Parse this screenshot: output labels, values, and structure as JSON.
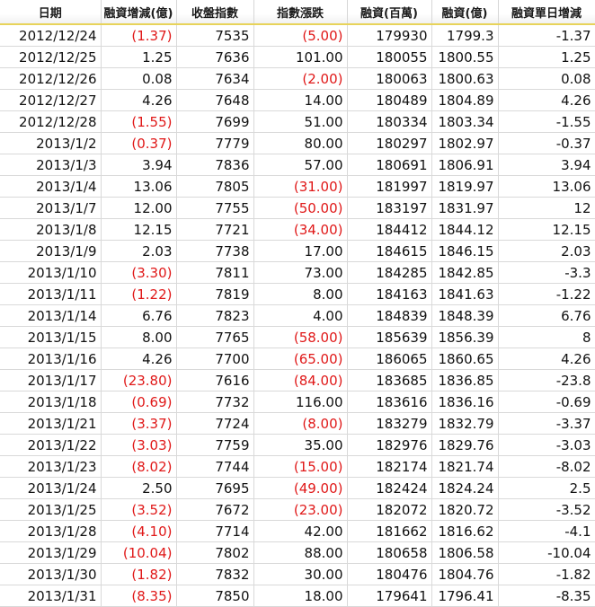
{
  "headers": [
    "日期",
    "融資增減(億)",
    "收盤指數",
    "指數漲跌",
    "融資(百萬)",
    "融資(億)",
    "融資單日增減"
  ],
  "colors": {
    "negative_text": "#e01818",
    "header_underline": "#e7d35a",
    "grid": "#d9d9d9"
  },
  "rows": [
    {
      "date": "2012/12/24",
      "margin_change": "(1.37)",
      "close": "7535",
      "index_change": "(5.00)",
      "margin_million": "179930",
      "margin_billion": "1799.3",
      "daily_change": "-1.37"
    },
    {
      "date": "2012/12/25",
      "margin_change": "1.25",
      "close": "7636",
      "index_change": "101.00",
      "margin_million": "180055",
      "margin_billion": "1800.55",
      "daily_change": "1.25"
    },
    {
      "date": "2012/12/26",
      "margin_change": "0.08",
      "close": "7634",
      "index_change": "(2.00)",
      "margin_million": "180063",
      "margin_billion": "1800.63",
      "daily_change": "0.08"
    },
    {
      "date": "2012/12/27",
      "margin_change": "4.26",
      "close": "7648",
      "index_change": "14.00",
      "margin_million": "180489",
      "margin_billion": "1804.89",
      "daily_change": "4.26"
    },
    {
      "date": "2012/12/28",
      "margin_change": "(1.55)",
      "close": "7699",
      "index_change": "51.00",
      "margin_million": "180334",
      "margin_billion": "1803.34",
      "daily_change": "-1.55"
    },
    {
      "date": "2013/1/2",
      "margin_change": "(0.37)",
      "close": "7779",
      "index_change": "80.00",
      "margin_million": "180297",
      "margin_billion": "1802.97",
      "daily_change": "-0.37"
    },
    {
      "date": "2013/1/3",
      "margin_change": "3.94",
      "close": "7836",
      "index_change": "57.00",
      "margin_million": "180691",
      "margin_billion": "1806.91",
      "daily_change": "3.94"
    },
    {
      "date": "2013/1/4",
      "margin_change": "13.06",
      "close": "7805",
      "index_change": "(31.00)",
      "margin_million": "181997",
      "margin_billion": "1819.97",
      "daily_change": "13.06"
    },
    {
      "date": "2013/1/7",
      "margin_change": "12.00",
      "close": "7755",
      "index_change": "(50.00)",
      "margin_million": "183197",
      "margin_billion": "1831.97",
      "daily_change": "12"
    },
    {
      "date": "2013/1/8",
      "margin_change": "12.15",
      "close": "7721",
      "index_change": "(34.00)",
      "margin_million": "184412",
      "margin_billion": "1844.12",
      "daily_change": "12.15"
    },
    {
      "date": "2013/1/9",
      "margin_change": "2.03",
      "close": "7738",
      "index_change": "17.00",
      "margin_million": "184615",
      "margin_billion": "1846.15",
      "daily_change": "2.03"
    },
    {
      "date": "2013/1/10",
      "margin_change": "(3.30)",
      "close": "7811",
      "index_change": "73.00",
      "margin_million": "184285",
      "margin_billion": "1842.85",
      "daily_change": "-3.3"
    },
    {
      "date": "2013/1/11",
      "margin_change": "(1.22)",
      "close": "7819",
      "index_change": "8.00",
      "margin_million": "184163",
      "margin_billion": "1841.63",
      "daily_change": "-1.22"
    },
    {
      "date": "2013/1/14",
      "margin_change": "6.76",
      "close": "7823",
      "index_change": "4.00",
      "margin_million": "184839",
      "margin_billion": "1848.39",
      "daily_change": "6.76"
    },
    {
      "date": "2013/1/15",
      "margin_change": "8.00",
      "close": "7765",
      "index_change": "(58.00)",
      "margin_million": "185639",
      "margin_billion": "1856.39",
      "daily_change": "8"
    },
    {
      "date": "2013/1/16",
      "margin_change": "4.26",
      "close": "7700",
      "index_change": "(65.00)",
      "margin_million": "186065",
      "margin_billion": "1860.65",
      "daily_change": "4.26"
    },
    {
      "date": "2013/1/17",
      "margin_change": "(23.80)",
      "close": "7616",
      "index_change": "(84.00)",
      "margin_million": "183685",
      "margin_billion": "1836.85",
      "daily_change": "-23.8"
    },
    {
      "date": "2013/1/18",
      "margin_change": "(0.69)",
      "close": "7732",
      "index_change": "116.00",
      "margin_million": "183616",
      "margin_billion": "1836.16",
      "daily_change": "-0.69"
    },
    {
      "date": "2013/1/21",
      "margin_change": "(3.37)",
      "close": "7724",
      "index_change": "(8.00)",
      "margin_million": "183279",
      "margin_billion": "1832.79",
      "daily_change": "-3.37"
    },
    {
      "date": "2013/1/22",
      "margin_change": "(3.03)",
      "close": "7759",
      "index_change": "35.00",
      "margin_million": "182976",
      "margin_billion": "1829.76",
      "daily_change": "-3.03"
    },
    {
      "date": "2013/1/23",
      "margin_change": "(8.02)",
      "close": "7744",
      "index_change": "(15.00)",
      "margin_million": "182174",
      "margin_billion": "1821.74",
      "daily_change": "-8.02"
    },
    {
      "date": "2013/1/24",
      "margin_change": "2.50",
      "close": "7695",
      "index_change": "(49.00)",
      "margin_million": "182424",
      "margin_billion": "1824.24",
      "daily_change": "2.5"
    },
    {
      "date": "2013/1/25",
      "margin_change": "(3.52)",
      "close": "7672",
      "index_change": "(23.00)",
      "margin_million": "182072",
      "margin_billion": "1820.72",
      "daily_change": "-3.52"
    },
    {
      "date": "2013/1/28",
      "margin_change": "(4.10)",
      "close": "7714",
      "index_change": "42.00",
      "margin_million": "181662",
      "margin_billion": "1816.62",
      "daily_change": "-4.1"
    },
    {
      "date": "2013/1/29",
      "margin_change": "(10.04)",
      "close": "7802",
      "index_change": "88.00",
      "margin_million": "180658",
      "margin_billion": "1806.58",
      "daily_change": "-10.04"
    },
    {
      "date": "2013/1/30",
      "margin_change": "(1.82)",
      "close": "7832",
      "index_change": "30.00",
      "margin_million": "180476",
      "margin_billion": "1804.76",
      "daily_change": "-1.82"
    },
    {
      "date": "2013/1/31",
      "margin_change": "(8.35)",
      "close": "7850",
      "index_change": "18.00",
      "margin_million": "179641",
      "margin_billion": "1796.41",
      "daily_change": "-8.35"
    }
  ]
}
